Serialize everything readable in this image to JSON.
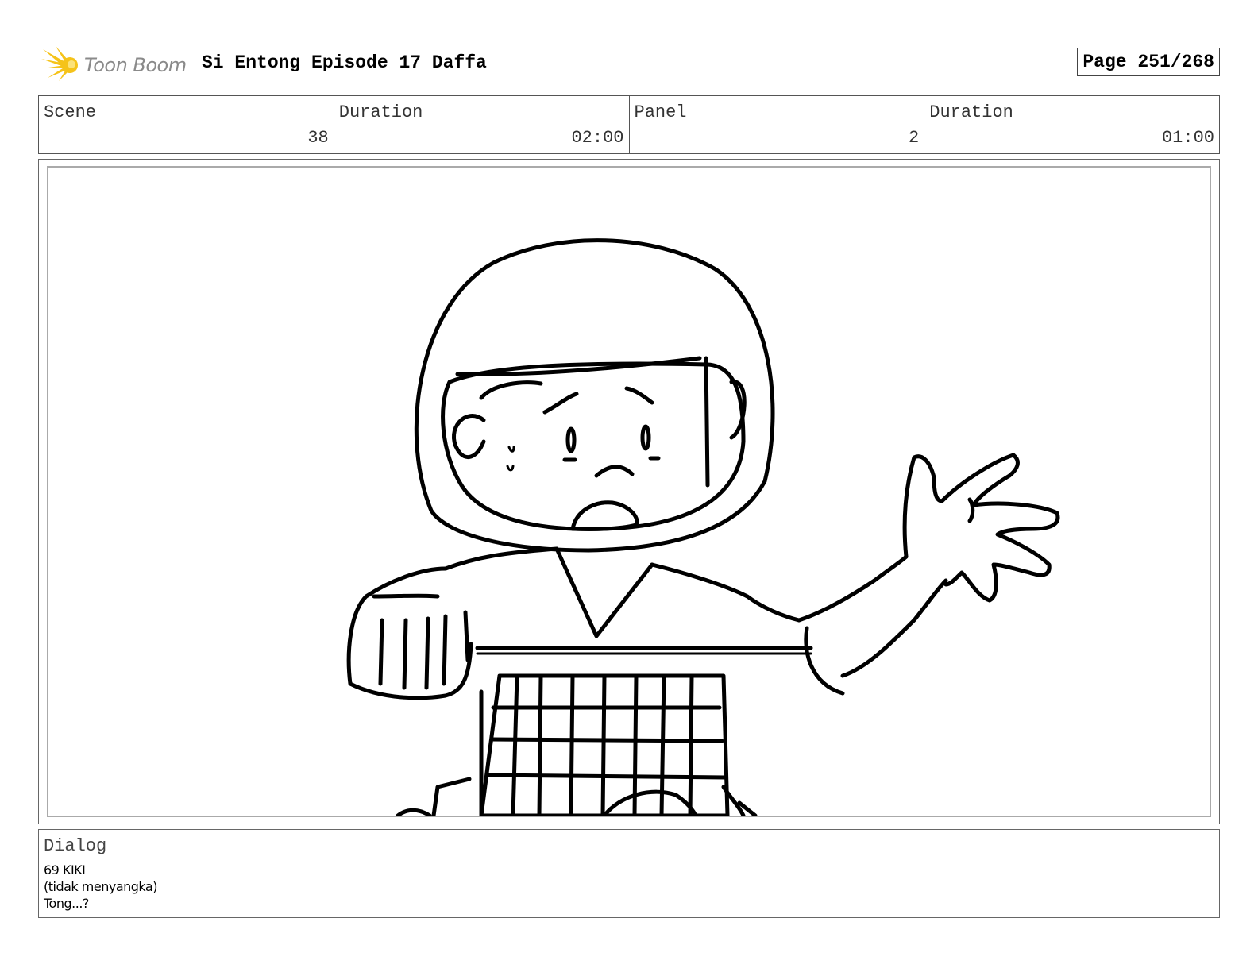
{
  "header": {
    "logo_text": "Toon Boom",
    "title": "Si Entong Episode 17 Daffa",
    "page": "Page 251/268"
  },
  "info": {
    "scene_label": "Scene",
    "scene_value": "38",
    "scene_duration_label": "Duration",
    "scene_duration_value": "02:00",
    "panel_label": "Panel",
    "panel_value": "2",
    "panel_duration_label": "Duration",
    "panel_duration_value": "01:00"
  },
  "dialog": {
    "label": "Dialog",
    "lines": [
      "69 KIKI",
      "(tidak menyangka)",
      "Tong...?"
    ]
  },
  "colors": {
    "logo_accent": "#f5c31a",
    "logo_text": "#8a8a8a"
  }
}
